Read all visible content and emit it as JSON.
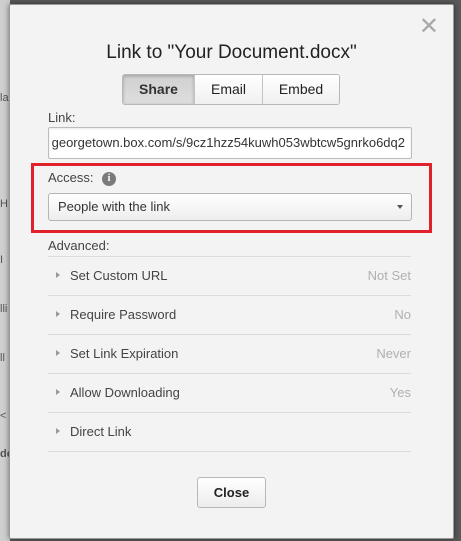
{
  "background": {
    "glyphs": [
      "la",
      "H",
      "I",
      "lli",
      "ll",
      "<",
      "do"
    ]
  },
  "dialog": {
    "title": "Link to \"Your Document.docx\"",
    "close_icon": "close-icon",
    "tabs": [
      {
        "label": "Share",
        "active": true
      },
      {
        "label": "Email",
        "active": false
      },
      {
        "label": "Embed",
        "active": false
      }
    ],
    "link_label": "Link:",
    "link_value": "https://georgetown.box.com/s/9cz1hzz54kuwh053wbtcw5gnrko6dq2",
    "link_visible": "georgetown.box.com/s/9cz1hzz54kuwh053wbtcw5gnrko6dq2",
    "access_label": "Access:",
    "access_info_icon": "info-icon",
    "access_value": "People with the link",
    "advanced_label": "Advanced:",
    "advanced_rows": [
      {
        "label": "Set Custom URL",
        "value": "Not Set"
      },
      {
        "label": "Require Password",
        "value": "No"
      },
      {
        "label": "Set Link Expiration",
        "value": "Never"
      },
      {
        "label": "Allow Downloading",
        "value": "Yes"
      },
      {
        "label": "Direct Link",
        "value": ""
      }
    ],
    "close_button": "Close"
  },
  "colors": {
    "highlight": "#e0202a",
    "modal_bg": "#f3f3f3"
  }
}
